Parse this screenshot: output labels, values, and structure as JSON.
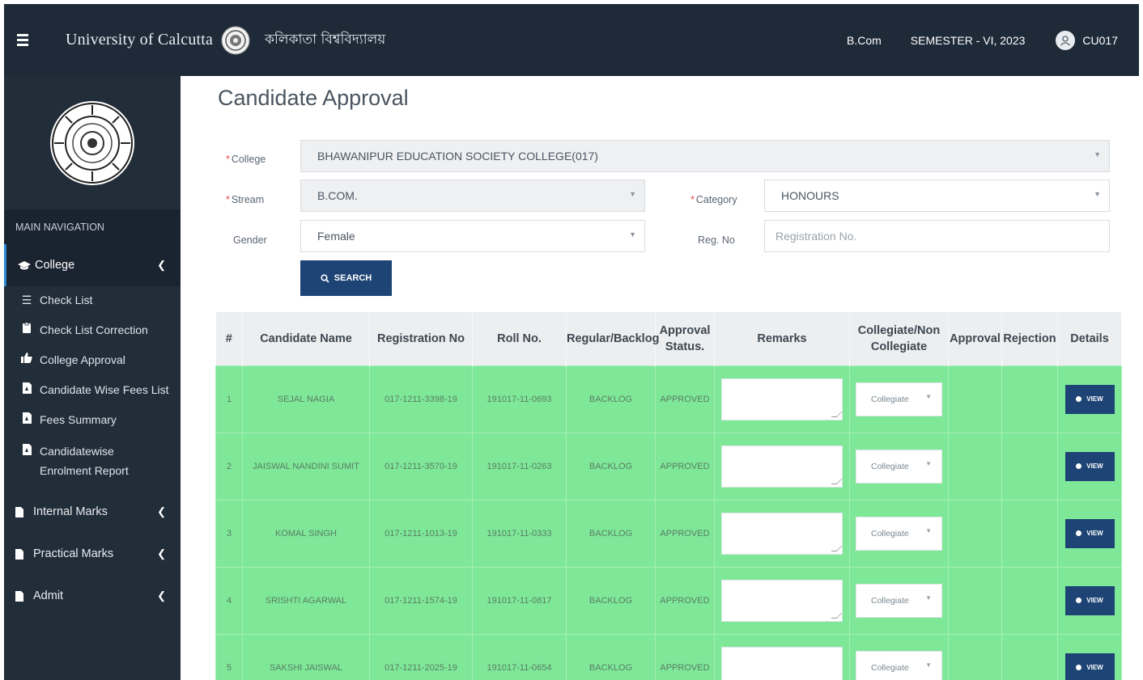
{
  "header": {
    "brand": "University of Calcutta",
    "brand_bengali": "কলিকাতা বিশ্ববিদ্যালয়",
    "course": "B.Com",
    "semester": "SEMESTER - VI, 2023",
    "user": "CU017"
  },
  "sidebar": {
    "main_nav_label": "MAIN NAVIGATION",
    "active_item": "College",
    "sub_items": [
      {
        "label": "Check List",
        "icon": "list-icon"
      },
      {
        "label": "Check List Correction",
        "icon": "clipboard-icon"
      },
      {
        "label": "College Approval",
        "icon": "thumbs-up-icon"
      },
      {
        "label": "Candidate Wise Fees List",
        "icon": "pdf-file-icon"
      },
      {
        "label": "Fees Summary",
        "icon": "pdf-file-icon"
      },
      {
        "label": "Candidatewise Enrolment Report",
        "icon": "pdf-file-icon"
      }
    ],
    "groups": [
      {
        "label": "Internal Marks",
        "icon": "file-icon"
      },
      {
        "label": "Practical Marks",
        "icon": "file-icon"
      },
      {
        "label": "Admit",
        "icon": "file-icon"
      }
    ]
  },
  "main": {
    "page_title": "Candidate Approval",
    "filters": {
      "college_label": "College",
      "college_value": "BHAWANIPUR EDUCATION SOCIETY COLLEGE(017)",
      "stream_label": "Stream",
      "stream_value": "B.COM.",
      "category_label": "Category",
      "category_value": "HONOURS",
      "gender_label": "Gender",
      "gender_value": "Female",
      "regno_label": "Reg. No",
      "regno_placeholder": "Registration No."
    },
    "search_label": "SEARCH",
    "table": {
      "headers": {
        "num": "#",
        "name": "Candidate Name",
        "reg": "Registration No",
        "roll": "Roll No.",
        "regular": "Regular/Backlog",
        "approval_status": "Approval Status.",
        "remarks": "Remarks",
        "collegiate": "Collegiate/Non Collegiate",
        "approval": "Approval",
        "rejection": "Rejection",
        "details": "Details"
      },
      "view_label": "VIEW",
      "rows": [
        {
          "num": "1",
          "name": "SEJAL NAGIA",
          "reg": "017-1211-3398-19",
          "roll": "191017-11-0693",
          "type": "BACKLOG",
          "status": "APPROVED",
          "collegiate": "Collegiate"
        },
        {
          "num": "2",
          "name": "JAISWAL NANDINI SUMIT",
          "reg": "017-1211-3570-19",
          "roll": "191017-11-0263",
          "type": "BACKLOG",
          "status": "APPROVED",
          "collegiate": "Collegiate"
        },
        {
          "num": "3",
          "name": "KOMAL SINGH",
          "reg": "017-1211-1013-19",
          "roll": "191017-11-0333",
          "type": "BACKLOG",
          "status": "APPROVED",
          "collegiate": "Collegiate"
        },
        {
          "num": "4",
          "name": "SRISHTI AGARWAL",
          "reg": "017-1211-1574-19",
          "roll": "191017-11-0817",
          "type": "BACKLOG",
          "status": "APPROVED",
          "collegiate": "Collegiate"
        },
        {
          "num": "5",
          "name": "SAKSHI JAISWAL",
          "reg": "017-1211-2025-19",
          "roll": "191017-11-0654",
          "type": "BACKLOG",
          "status": "APPROVED",
          "collegiate": "Collegiate"
        }
      ]
    }
  },
  "colors": {
    "header_bg": "#1e2a38",
    "sidebar_bg": "#222d3a",
    "row_approved": "#7ee898",
    "button": "#1d4474"
  }
}
